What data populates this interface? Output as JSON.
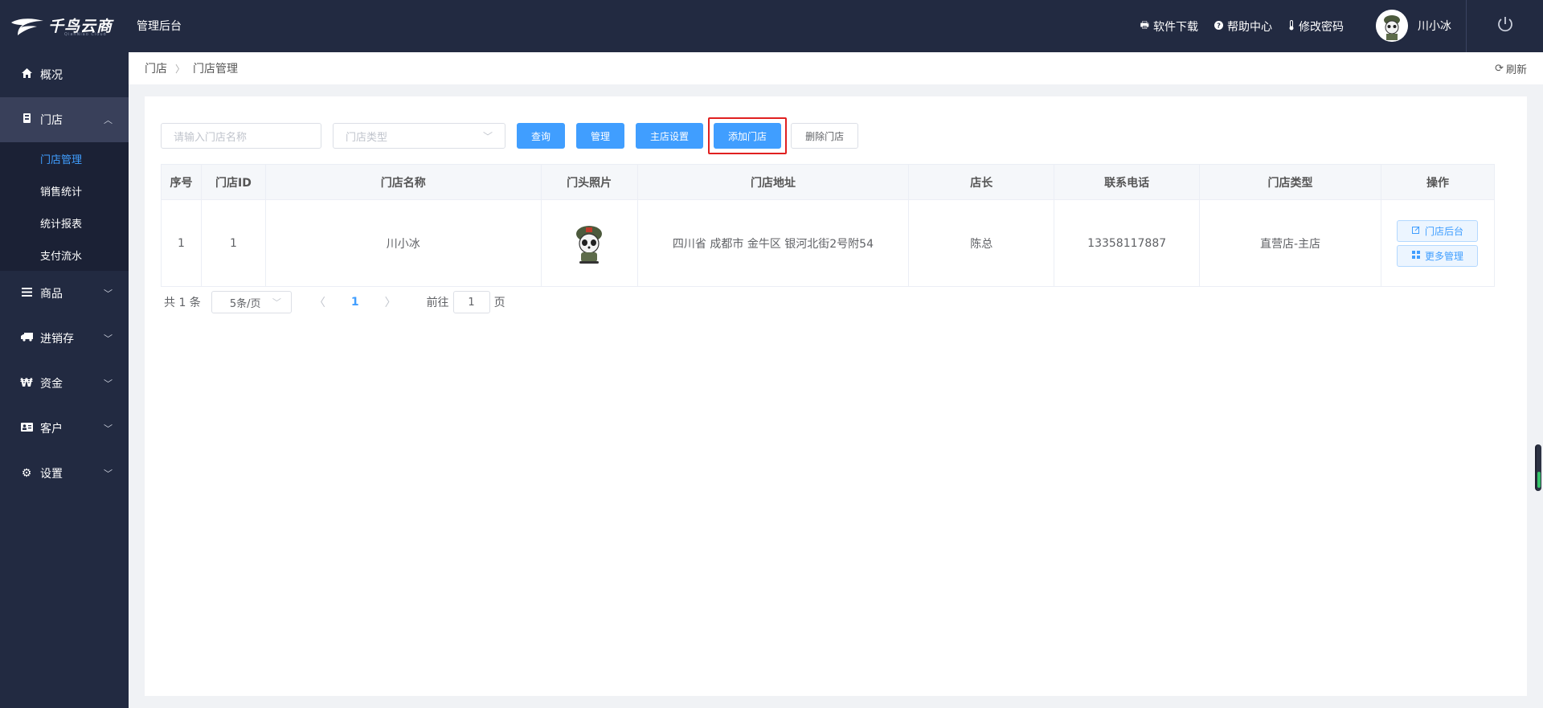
{
  "header": {
    "brand": "千鸟云商",
    "brand_sub": "QianNiao Cloud",
    "title": "管理后台",
    "links": [
      {
        "label": "软件下载",
        "icon": "printer-icon"
      },
      {
        "label": "帮助中心",
        "icon": "question-circle-icon"
      },
      {
        "label": "修改密码",
        "icon": "thermometer-icon"
      }
    ],
    "user_name": "川小冰"
  },
  "sidebar": {
    "items": [
      {
        "label": "概况",
        "icon": "home-icon"
      },
      {
        "label": "门店",
        "icon": "store-icon"
      },
      {
        "label": "商品",
        "icon": "list-icon"
      },
      {
        "label": "进销存",
        "icon": "truck-icon"
      },
      {
        "label": "资金",
        "icon": "won-icon"
      },
      {
        "label": "客户",
        "icon": "id-card-icon"
      },
      {
        "label": "设置",
        "icon": "gear-icon"
      }
    ],
    "submenu": [
      "门店管理",
      "销售统计",
      "统计报表",
      "支付流水"
    ]
  },
  "breadcrumb": {
    "items": [
      "门店",
      "门店管理"
    ],
    "refresh_label": "刷新"
  },
  "toolbar": {
    "search_placeholder": "请输入门店名称",
    "type_placeholder": "门店类型",
    "query_label": "查询",
    "manage_label": "管理",
    "main_store_label": "主店设置",
    "add_store_label": "添加门店",
    "delete_store_label": "删除门店"
  },
  "table": {
    "headers": [
      "序号",
      "门店ID",
      "门店名称",
      "门头照片",
      "门店地址",
      "店长",
      "联系电话",
      "门店类型",
      "操作"
    ],
    "rows": [
      {
        "index": "1",
        "id": "1",
        "name": "川小冰",
        "address": "四川省 成都市 金牛区 银河北街2号附54",
        "manager": "陈总",
        "phone": "13358117887",
        "type": "直营店-主店",
        "op_backend": "门店后台",
        "op_more": "更多管理"
      }
    ]
  },
  "pagination": {
    "total": "共 1 条",
    "page_size": "5条/页",
    "current": "1",
    "goto_prefix": "前往",
    "goto_value": "1",
    "goto_suffix": "页"
  },
  "colors": {
    "sidebar_bg": "#222a41",
    "primary": "#409eff",
    "highlight_border": "#e02020"
  }
}
